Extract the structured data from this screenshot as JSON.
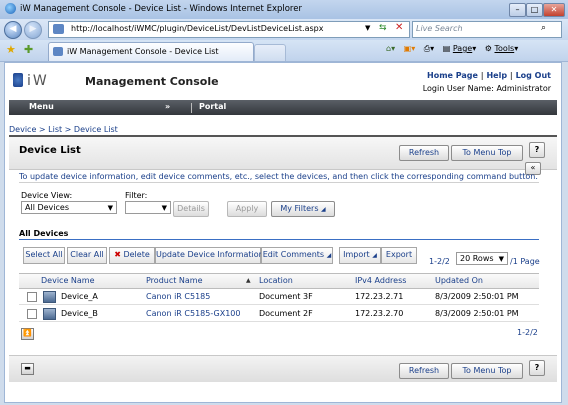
{
  "window": {
    "title": "iW Management Console - Device List - Windows Internet Explorer"
  },
  "browser": {
    "url": "http://localhost/iWMC/plugin/DeviceList/DevListDeviceList.aspx",
    "search_placeholder": "Live Search",
    "tab_title": "iW Management Console - Device List",
    "page_menu": "Page",
    "tools_menu": "Tools"
  },
  "header": {
    "logo_text": "iW",
    "app_name": "Management Console",
    "home_link": "Home Page",
    "help_link": "Help",
    "logout_link": "Log Out",
    "login_user": "Login User Name: Administrator"
  },
  "menubar": {
    "menu_label": "Menu",
    "portal_label": "Portal"
  },
  "breadcrumb": "Device > List > Device List",
  "panel": {
    "title": "Device List",
    "refresh_label": "Refresh",
    "menu_top_label": "To Menu Top",
    "help_label": "?",
    "collapse_label": "«",
    "info_text": "To update device information, edit device comments, etc., select the devices, and then click the corresponding command button."
  },
  "filters": {
    "device_view_label": "Device View:",
    "device_view_value": "All Devices",
    "filter_label": "Filter:",
    "filter_value": "",
    "details_label": "Details",
    "apply_label": "Apply",
    "my_filters_label": "My Filters"
  },
  "section": {
    "title": "All Devices"
  },
  "toolbar": {
    "select_all": "Select All",
    "clear_all": "Clear All",
    "delete": "Delete",
    "update_device_info": "Update Device Information",
    "edit_comments": "Edit Comments",
    "import": "Import",
    "export": "Export",
    "page_range": "1-2/2",
    "rows_per_page": "20 Rows",
    "page_count": "/1 Page"
  },
  "table": {
    "columns": [
      "Device Name",
      "Product Name",
      "Location",
      "IPv4 Address",
      "Updated On"
    ],
    "rows": [
      {
        "device_name": "Device_A",
        "product_name": "Canon iR C5185",
        "location": "Document 3F",
        "ipv4": "172.23.2.71",
        "updated_on": "8/3/2009 2:50:01 PM"
      },
      {
        "device_name": "Device_B",
        "product_name": "Canon iR C5185-GX100",
        "location": "Document 2F",
        "ipv4": "172.23.2.70",
        "updated_on": "8/3/2009 2:50:01 PM"
      }
    ],
    "footer_range": "1-2/2"
  },
  "bottom": {
    "refresh_label": "Refresh",
    "menu_top_label": "To Menu Top",
    "help_label": "?"
  },
  "colors": {
    "link": "#1a3f8a",
    "accent_line": "#3a6fc4",
    "delete_x": "#cc0000"
  }
}
